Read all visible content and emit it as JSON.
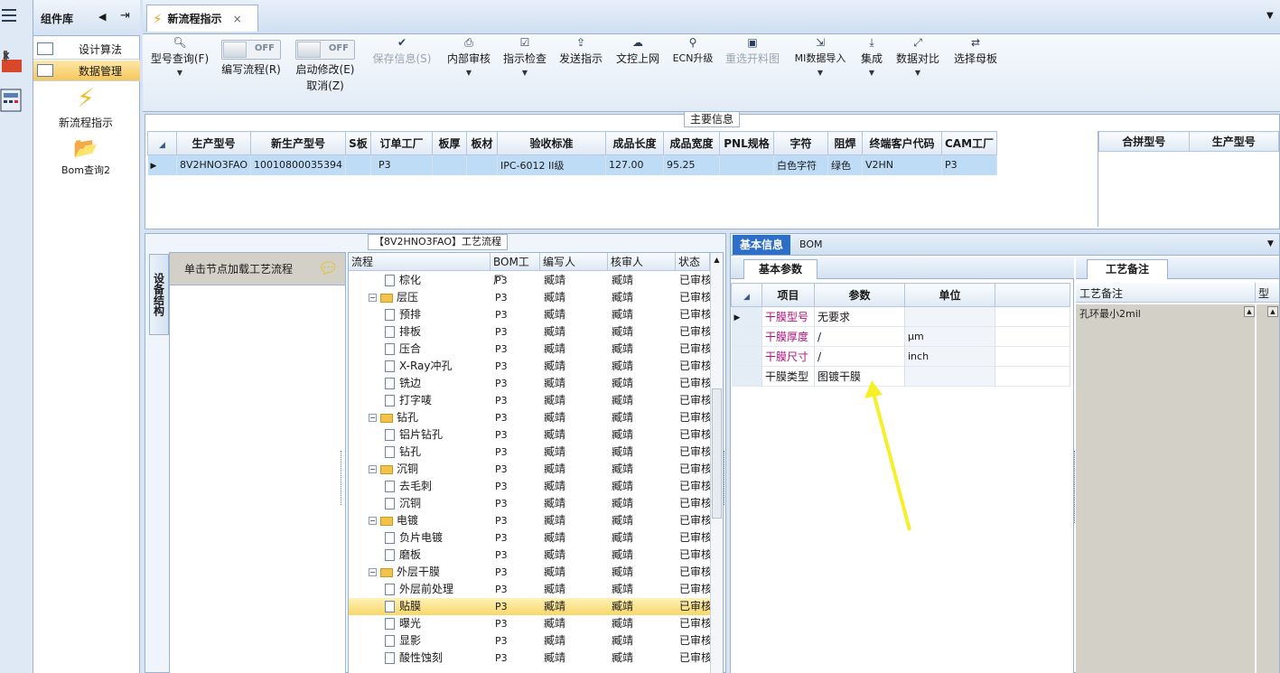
{
  "sidebar": {
    "title": "组件库",
    "items": [
      {
        "label": "设计算法"
      },
      {
        "label": "数据管理"
      }
    ],
    "shortcuts": [
      {
        "label": "新流程指示"
      },
      {
        "label": "Bom查询2"
      }
    ]
  },
  "tabs": [
    {
      "label": "新流程指示",
      "close": "×"
    }
  ],
  "toolbar": {
    "model_query": "型号查询(F)",
    "write_flow": "编写流程(R)",
    "toggle_off": "OFF",
    "enable_edit": "启动修改(E)",
    "cancel": "取消(Z)",
    "save_info": "保存信息(S)",
    "internal_review": "内部审核",
    "instruction_check": "指示检查",
    "send_instruction": "发送指示",
    "upload": "文控上网",
    "ecn_upgrade": "ECN升级",
    "replace_cut_map": "重选开料图",
    "mi_import": "MI数据导入",
    "integrate": "集成",
    "data_compare": "数据对比",
    "select_master": "选择母板"
  },
  "main_info": {
    "section_label": "主要信息",
    "columns": [
      "生产型号",
      "新生产型号",
      "S板",
      "订单工厂",
      "板厚",
      "板材",
      "验收标准",
      "成品长度",
      "成品宽度",
      "PNL规格",
      "字符",
      "阻焊",
      "终端客户代码",
      "CAM工厂"
    ],
    "row": [
      "8V2HNO3FAO",
      "10010800035394",
      "",
      "P3",
      "",
      "",
      "IPC-6012 II级",
      "127.00",
      "95.25",
      "",
      "白色字符",
      "绿色",
      "V2HN",
      "P3"
    ],
    "side_columns": [
      "合拼型号",
      "生产型号"
    ]
  },
  "process": {
    "title": "【8V2HNO3FAO】工艺流程",
    "vertical_tab": "设备结构",
    "node_hint": "单击节点加载工艺流程",
    "columns": [
      "流程",
      "BOM工厂",
      "编写人",
      "核审人",
      "状态"
    ],
    "rows": [
      {
        "name": "棕化",
        "level": 2,
        "type": "doc",
        "factory": "P3",
        "writer": "臧靖",
        "reviewer": "臧靖",
        "status": "已审核"
      },
      {
        "name": "层压",
        "level": 1,
        "type": "folder",
        "factory": "P3",
        "writer": "臧靖",
        "reviewer": "臧靖",
        "status": "已审核"
      },
      {
        "name": "预排",
        "level": 2,
        "type": "doc",
        "factory": "P3",
        "writer": "臧靖",
        "reviewer": "臧靖",
        "status": "已审核"
      },
      {
        "name": "排板",
        "level": 2,
        "type": "doc",
        "factory": "P3",
        "writer": "臧靖",
        "reviewer": "臧靖",
        "status": "已审核"
      },
      {
        "name": "压合",
        "level": 2,
        "type": "doc",
        "factory": "P3",
        "writer": "臧靖",
        "reviewer": "臧靖",
        "status": "已审核"
      },
      {
        "name": "X-Ray冲孔",
        "level": 2,
        "type": "doc",
        "factory": "P3",
        "writer": "臧靖",
        "reviewer": "臧靖",
        "status": "已审核"
      },
      {
        "name": "铣边",
        "level": 2,
        "type": "doc",
        "factory": "P3",
        "writer": "臧靖",
        "reviewer": "臧靖",
        "status": "已审核"
      },
      {
        "name": "打字唛",
        "level": 2,
        "type": "doc",
        "factory": "P3",
        "writer": "臧靖",
        "reviewer": "臧靖",
        "status": "已审核"
      },
      {
        "name": "钻孔",
        "level": 1,
        "type": "folder",
        "factory": "P3",
        "writer": "臧靖",
        "reviewer": "臧靖",
        "status": "已审核"
      },
      {
        "name": "铝片钻孔",
        "level": 2,
        "type": "doc",
        "factory": "P3",
        "writer": "臧靖",
        "reviewer": "臧靖",
        "status": "已审核"
      },
      {
        "name": "钻孔",
        "level": 2,
        "type": "doc",
        "factory": "P3",
        "writer": "臧靖",
        "reviewer": "臧靖",
        "status": "已审核"
      },
      {
        "name": "沉铜",
        "level": 1,
        "type": "folder",
        "factory": "P3",
        "writer": "臧靖",
        "reviewer": "臧靖",
        "status": "已审核"
      },
      {
        "name": "去毛刺",
        "level": 2,
        "type": "doc",
        "factory": "P3",
        "writer": "臧靖",
        "reviewer": "臧靖",
        "status": "已审核"
      },
      {
        "name": "沉铜",
        "level": 2,
        "type": "doc",
        "factory": "P3",
        "writer": "臧靖",
        "reviewer": "臧靖",
        "status": "已审核"
      },
      {
        "name": "电镀",
        "level": 1,
        "type": "folder",
        "factory": "P3",
        "writer": "臧靖",
        "reviewer": "臧靖",
        "status": "已审核"
      },
      {
        "name": "负片电镀",
        "level": 2,
        "type": "doc",
        "factory": "P3",
        "writer": "臧靖",
        "reviewer": "臧靖",
        "status": "已审核"
      },
      {
        "name": "磨板",
        "level": 2,
        "type": "doc",
        "factory": "P3",
        "writer": "臧靖",
        "reviewer": "臧靖",
        "status": "已审核"
      },
      {
        "name": "外层干膜",
        "level": 1,
        "type": "folder",
        "factory": "P3",
        "writer": "臧靖",
        "reviewer": "臧靖",
        "status": "已审核"
      },
      {
        "name": "外层前处理",
        "level": 2,
        "type": "doc",
        "factory": "P3",
        "writer": "臧靖",
        "reviewer": "臧靖",
        "status": "已审核"
      },
      {
        "name": "贴膜",
        "level": 2,
        "type": "doc",
        "factory": "P3",
        "writer": "臧靖",
        "reviewer": "臧靖",
        "status": "已审核",
        "selected": true
      },
      {
        "name": "曝光",
        "level": 2,
        "type": "doc",
        "factory": "P3",
        "writer": "臧靖",
        "reviewer": "臧靖",
        "status": "已审核"
      },
      {
        "name": "显影",
        "level": 2,
        "type": "doc",
        "factory": "P3",
        "writer": "臧靖",
        "reviewer": "臧靖",
        "status": "已审核"
      },
      {
        "name": "酸性蚀刻",
        "level": 2,
        "type": "doc",
        "factory": "P3",
        "writer": "臧靖",
        "reviewer": "臧靖",
        "status": "已审核"
      }
    ]
  },
  "detail": {
    "tab_basic": "基本信息",
    "tab_bom": "BOM",
    "params_tab": "基本参数",
    "remarks_tab": "工艺备注",
    "param_columns": [
      "项目",
      "参数",
      "单位"
    ],
    "params": [
      {
        "item": "干膜型号",
        "value": "无要求",
        "unit": "",
        "highlight": true
      },
      {
        "item": "干膜厚度",
        "value": "/",
        "unit": "μm",
        "highlight": true
      },
      {
        "item": "干膜尺寸",
        "value": "/",
        "unit": "inch",
        "highlight": true
      },
      {
        "item": "干膜类型",
        "value": "图镀干膜",
        "unit": "",
        "highlight": false
      }
    ],
    "remark_columns": [
      "工艺备注",
      "型"
    ],
    "remark_text": "孔环最小2mil",
    "arrow_color": "#f5f02a"
  }
}
